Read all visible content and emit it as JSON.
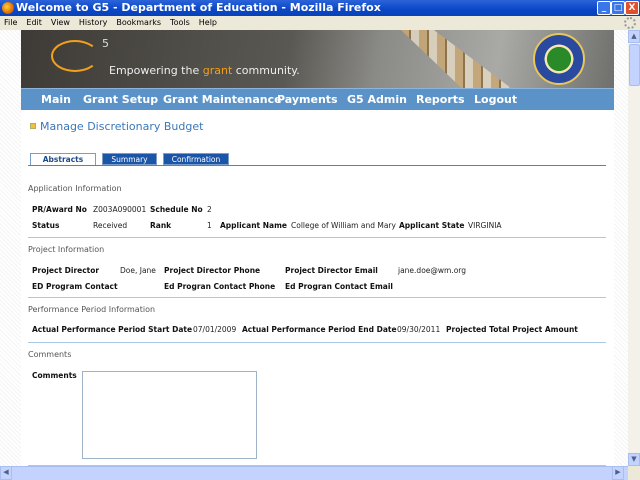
{
  "window": {
    "title": "Welcome to G5 - Department of Education - Mozilla Firefox",
    "min": "_",
    "max": "□",
    "close": "X"
  },
  "menu": [
    "File",
    "Edit",
    "View",
    "History",
    "Bookmarks",
    "Tools",
    "Help"
  ],
  "banner": {
    "logo": "G",
    "logo_sup": "5",
    "tagline_pre": "Empowering the ",
    "tagline_hl": "grant",
    "tagline_post": " community."
  },
  "nav": [
    "Main",
    "Grant Setup",
    "Grant Maintenance",
    "Payments",
    "G5 Admin",
    "Reports",
    "Logout"
  ],
  "page_title": "Manage Discretionary Budget",
  "tabs": [
    "Abstracts",
    "Summary",
    "Confirmation"
  ],
  "application": {
    "heading": "Application Information",
    "pr_label": "PR/Award No",
    "pr": "Z003A090001",
    "sched_label": "Schedule No",
    "sched": "2",
    "status_label": "Status",
    "status": "Received",
    "rank_label": "Rank",
    "rank": "1",
    "appname_label": "Applicant Name",
    "appname": "College of William and Mary",
    "state_label": "Applicant State",
    "state": "VIRGINIA"
  },
  "project": {
    "heading": "Project Information",
    "pd_label": "Project Director",
    "pd": "Doe, Jane",
    "pdphone_label": "Project Director Phone",
    "pdemail_label": "Project Director Email",
    "pdemail": "jane.doe@wm.org",
    "ed_label": "ED Program Contact",
    "edphone_label": "Ed Progran Contact Phone",
    "edemail_label": "Ed Progran Contact Email"
  },
  "performance": {
    "heading": "Performance Period Information",
    "start_label": "Actual Performance Period Start Date",
    "start": "07/01/2009",
    "end_label": "Actual Performance Period End Date",
    "end": "09/30/2011",
    "amount_label": "Projected Total Project Amount"
  },
  "comments": {
    "heading": "Comments",
    "label": "Comments",
    "value": ""
  }
}
